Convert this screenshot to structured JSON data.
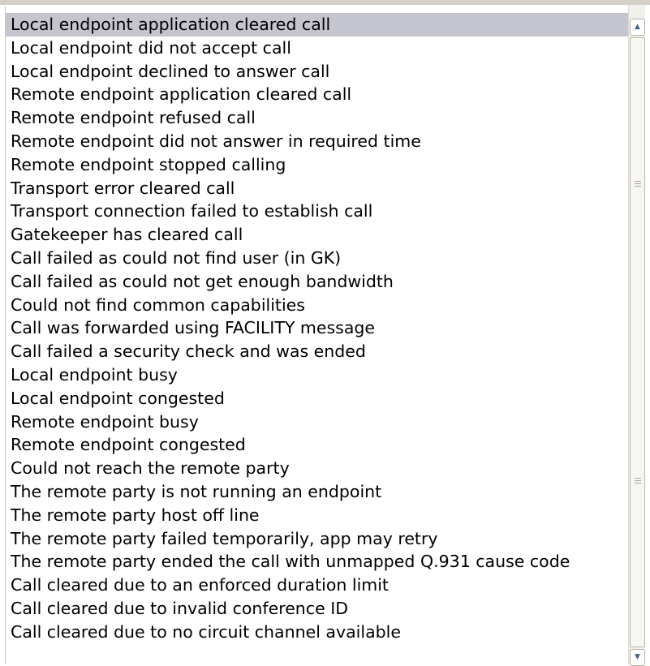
{
  "listbox": {
    "selected_index": 0,
    "items": [
      "Local endpoint application cleared call",
      "Local endpoint did not accept call",
      "Local endpoint declined to answer call",
      "Remote endpoint application cleared call",
      "Remote endpoint refused call",
      "Remote endpoint did not answer in required time",
      "Remote endpoint stopped calling",
      "Transport error cleared call",
      "Transport connection failed to establish call",
      "Gatekeeper has cleared call",
      "Call failed as could not find user (in GK)",
      "Call failed as could not get enough bandwidth",
      "Could not find common capabilities",
      "Call was forwarded using FACILITY message",
      "Call failed a security check and was ended",
      "Local endpoint busy",
      "Local endpoint congested",
      "Remote endpoint busy",
      "Remote endpoint congested",
      "Could not reach the remote party",
      "The remote party is not running an endpoint",
      "The remote party host off line",
      "The remote party failed temporarily, app may retry",
      "The remote party ended the call with unmapped Q.931 cause code",
      "Call cleared due to an enforced duration limit",
      "Call cleared due to invalid conference ID",
      "Call cleared due to no circuit channel available"
    ]
  },
  "scrollbar": {
    "up_icon": "chevron-up-icon",
    "down_icon": "chevron-down-icon"
  },
  "colors": {
    "selection": "#c5c5d0",
    "arrow": "#4d6185"
  }
}
